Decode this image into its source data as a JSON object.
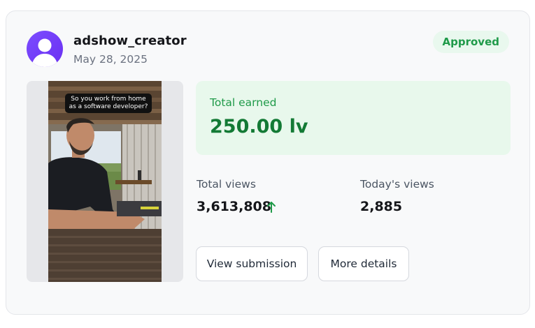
{
  "submission": {
    "username": "adshow_creator",
    "date": "May 28, 2025",
    "status": "Approved",
    "video_caption": "So you work from home as a software developer?",
    "earned_label": "Total earned",
    "earned_value": "250.00 lv",
    "total_views_label": "Total views",
    "total_views_value": "3,613,808",
    "total_views_trend": "up-arrow-icon",
    "todays_views_label": "Today's views",
    "todays_views_value": "2,885",
    "buttons": {
      "view_submission": "View submission",
      "more_details": "More details"
    }
  },
  "colors": {
    "accent_green": "#1f9a49",
    "earned_green": "#137a35",
    "avatar_purple": "#6a2ff2",
    "badge_bg": "#e9f8ee",
    "earned_bg": "#e8f8ec"
  }
}
